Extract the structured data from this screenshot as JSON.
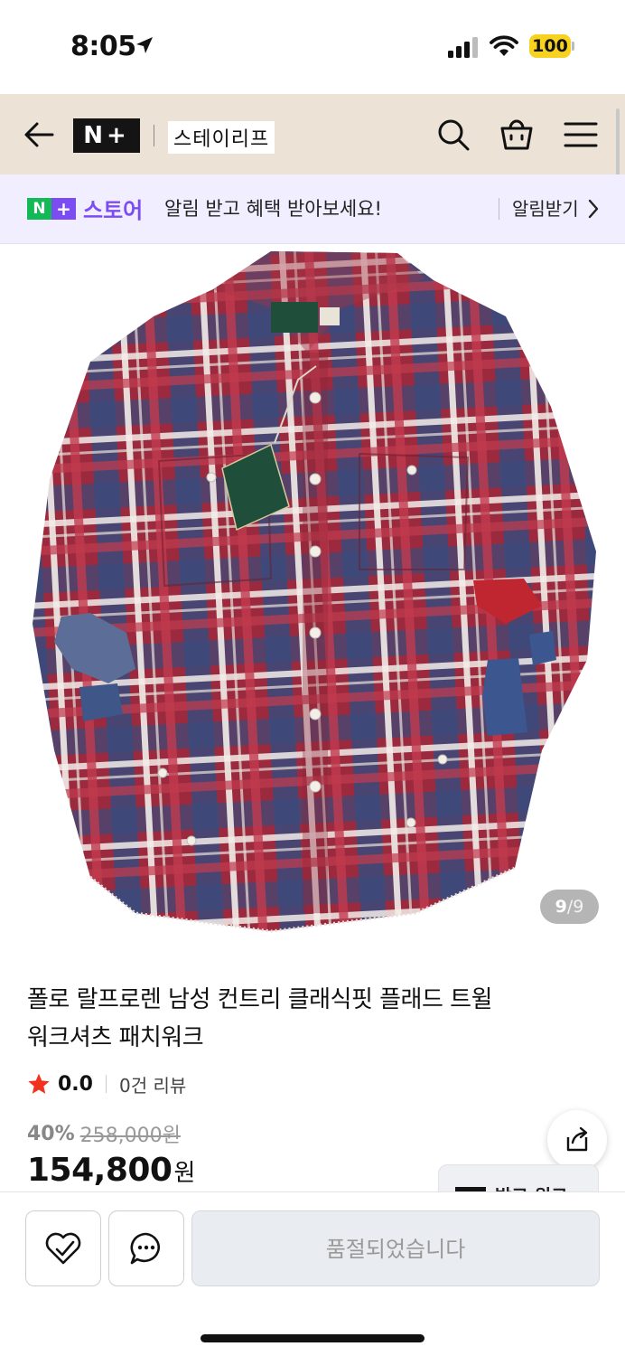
{
  "status_bar": {
    "time": "8:05",
    "battery": "100"
  },
  "header": {
    "store_name": "스테이리프",
    "logo_text": "N+"
  },
  "banner": {
    "badge_n": "N",
    "badge_plus": "+",
    "store_label": "스토어",
    "message": "알림 받고 혜택 받아보세요!",
    "action": "알림받기"
  },
  "image": {
    "current": "9",
    "separator": "/",
    "total": "9"
  },
  "product": {
    "title_line1": "폴로 랄프로렌 남성 컨트리 클래식핏 플래드 트윌",
    "title_line2": "워크셔츠 패치워크",
    "rating": "0.0",
    "review_count": "0건 리뷰",
    "discount_rate": "40%",
    "original_price": "258,000원",
    "sale_price": "154,800",
    "sale_unit": "원"
  },
  "peek_chip": {
    "label": "받고 워크"
  },
  "bottom_bar": {
    "buy_label": "품절되었습니다"
  },
  "colors": {
    "header_bg": "#ece3d6",
    "banner_bg": "#f1eeff",
    "naver_green": "#12b955",
    "naver_purple": "#7b4cf2",
    "star_red": "#f1321e",
    "battery_yellow": "#f7d21e",
    "shirt_red": "#9b2a3e",
    "shirt_navy": "#3b4a7c"
  }
}
